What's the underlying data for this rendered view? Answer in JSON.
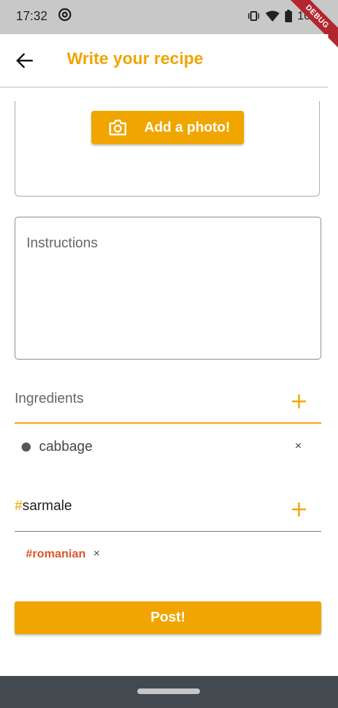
{
  "status_bar": {
    "time": "17:32",
    "battery": "100",
    "debug_label": "DEBUG"
  },
  "app_bar": {
    "title": "Write your recipe"
  },
  "photo_section": {
    "button_label": "Add a photo!"
  },
  "instructions": {
    "placeholder": "Instructions"
  },
  "ingredients": {
    "label": "Ingredients",
    "items": [
      {
        "name": "cabbage",
        "remove": "×"
      }
    ]
  },
  "tags": {
    "hash": "#",
    "input_value": "sarmale",
    "chips": [
      {
        "label": "#romanian",
        "remove": "×"
      }
    ]
  },
  "post": {
    "label": "Post!"
  },
  "colors": {
    "accent": "#f0a500",
    "chip_text": "#d85a2a"
  }
}
